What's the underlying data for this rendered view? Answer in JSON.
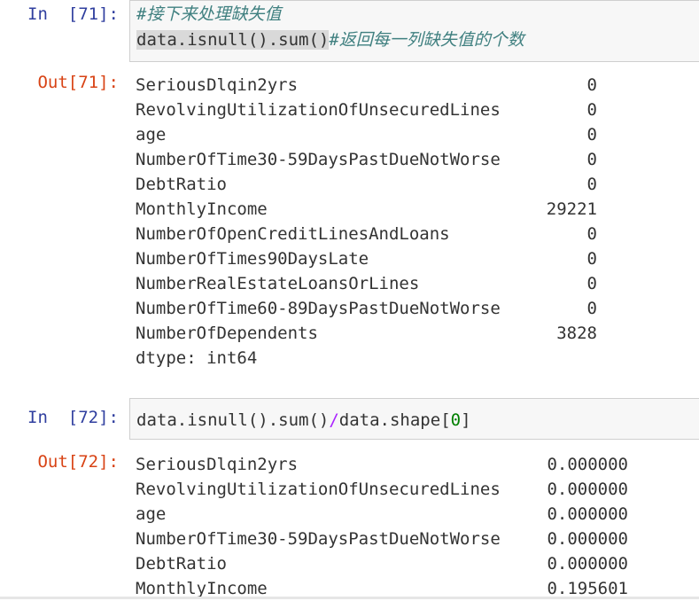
{
  "cell71": {
    "in_prompt": "In  [71]:",
    "comment_line": "#接下来处理缺失值",
    "code_main": "data.isnull().sum()",
    "code_comment": "#返回每一列缺失值的个数",
    "out_prompt": "Out[71]:",
    "rows": [
      {
        "label": "SeriousDlqin2yrs",
        "value": "0"
      },
      {
        "label": "RevolvingUtilizationOfUnsecuredLines",
        "value": "0"
      },
      {
        "label": "age",
        "value": "0"
      },
      {
        "label": "NumberOfTime30-59DaysPastDueNotWorse",
        "value": "0"
      },
      {
        "label": "DebtRatio",
        "value": "0"
      },
      {
        "label": "MonthlyIncome",
        "value": "29221"
      },
      {
        "label": "NumberOfOpenCreditLinesAndLoans",
        "value": "0"
      },
      {
        "label": "NumberOfTimes90DaysLate",
        "value": "0"
      },
      {
        "label": "NumberRealEstateLoansOrLines",
        "value": "0"
      },
      {
        "label": "NumberOfTime60-89DaysPastDueNotWorse",
        "value": "0"
      },
      {
        "label": "NumberOfDependents",
        "value": "3828"
      }
    ],
    "dtype": "dtype: int64"
  },
  "cell72": {
    "in_prompt": "In  [72]:",
    "code_a": "data.isnull().sum()",
    "code_op": "/",
    "code_b": "data.shape",
    "code_lb": "[",
    "code_num": "0",
    "code_rb": "]",
    "out_prompt": "Out[72]:",
    "rows": [
      {
        "label": "SeriousDlqin2yrs",
        "value": "0.000000"
      },
      {
        "label": "RevolvingUtilizationOfUnsecuredLines",
        "value": "0.000000"
      },
      {
        "label": "age",
        "value": "0.000000"
      },
      {
        "label": "NumberOfTime30-59DaysPastDueNotWorse",
        "value": "0.000000"
      },
      {
        "label": "DebtRatio",
        "value": "0.000000"
      },
      {
        "label": "MonthlyIncome",
        "value": "0.195601"
      }
    ]
  }
}
